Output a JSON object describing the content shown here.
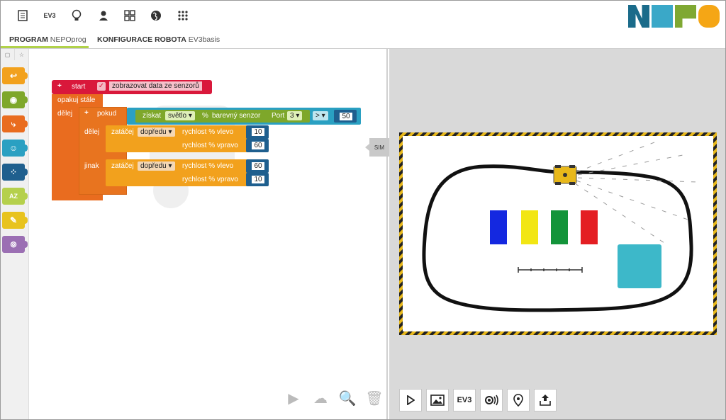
{
  "toolbar": {
    "items": [
      {
        "icon": "document-icon",
        "label": "▤"
      },
      {
        "icon": "ev3-icon",
        "label": "EV3"
      },
      {
        "icon": "lightbulb-icon",
        "label": "♨"
      },
      {
        "icon": "user-icon",
        "label": "●"
      },
      {
        "icon": "gallery-icon",
        "label": "▦"
      },
      {
        "icon": "globe-icon",
        "label": "◕"
      },
      {
        "icon": "apps-icon",
        "label": "⁙"
      }
    ]
  },
  "logo": {
    "colors": [
      "#1a6b8a",
      "#3aa8c8",
      "#7fa832",
      "#f5a615"
    ]
  },
  "tabs": {
    "program_label": "PROGRAM",
    "program_name": "NEPOprog",
    "config_label": "KONFIGURACE ROBOTA",
    "config_name": "EV3basis"
  },
  "palette": {
    "categories": [
      {
        "name": "action",
        "color": "#f2a11d"
      },
      {
        "name": "sensors",
        "color": "#7ea72a"
      },
      {
        "name": "control",
        "color": "#e96c1f"
      },
      {
        "name": "logic",
        "color": "#2aa0c2"
      },
      {
        "name": "math",
        "color": "#1f5f8e"
      },
      {
        "name": "text",
        "color": "#b5d04c"
      },
      {
        "name": "colour",
        "color": "#e8c31e"
      },
      {
        "name": "variables",
        "color": "#9b6fb3"
      }
    ]
  },
  "program": {
    "start": "start",
    "show_sensor_data": "zobrazovat data ze senzorů",
    "repeat_forever": "opakuj stále",
    "do": "dělej",
    "if": "pokud",
    "get": "získat",
    "mode": "světlo",
    "percent": "%",
    "sensor": "barevný senzor",
    "port_label": "Port",
    "port": "3",
    "operator": ">",
    "threshold": "50",
    "do2": "dělej",
    "else": "jinak",
    "steer": "zatáčej",
    "direction": "dopředu",
    "speed_left": "rychlost % vlevo",
    "speed_right": "rychlost % vpravo",
    "then_left": "10",
    "then_right": "60",
    "else_left": "60",
    "else_right": "10"
  },
  "sim": {
    "toggle": "SIM",
    "controls": [
      {
        "icon": "play-icon",
        "label": "▷"
      },
      {
        "icon": "image-icon",
        "label": "🖼"
      },
      {
        "icon": "ev3-icon",
        "label": "EV3"
      },
      {
        "icon": "sound-icon",
        "label": "◉))"
      },
      {
        "icon": "location-icon",
        "label": "⌖"
      },
      {
        "icon": "import-icon",
        "label": "⇪"
      }
    ],
    "colors": [
      "#1428e0",
      "#f2e614",
      "#13943a",
      "#e41e23",
      "#3db8c9"
    ]
  }
}
